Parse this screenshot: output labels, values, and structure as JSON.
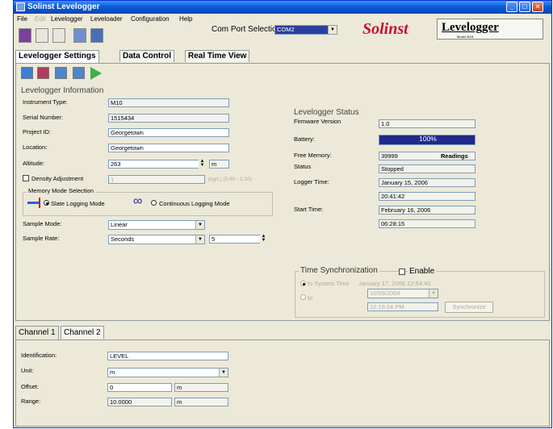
{
  "window": {
    "title": "Solinst Levelogger"
  },
  "menu": [
    "File",
    "Edit",
    "Levelogger",
    "Leveloader",
    "Configuration",
    "Help"
  ],
  "com_port": {
    "label": "Com Port Selection:",
    "value": "COM2"
  },
  "brand": {
    "name": "Solinst",
    "product": "Levelogger",
    "model": "Model 3001"
  },
  "tabs": [
    "Levelogger Settings",
    "Data Control",
    "Real Time View"
  ],
  "info": {
    "title": "Levelogger Information",
    "instrument_type_label": "Instrument Type:",
    "instrument_type": "M10",
    "serial_label": "Serial Number:",
    "serial": "1515434",
    "project_label": "Project ID:",
    "project": "Georgetown",
    "location_label": "Location:",
    "location": "Georgetown",
    "altitude_label": "Altitude:",
    "altitude": "263",
    "altitude_unit": "m",
    "density_label": "Density Adjustment",
    "density_value": "1",
    "density_range": "(kg/L) (0.90 - 1.10)",
    "memory_title": "Memory Mode Selection",
    "slate_label": "Slate Logging Mode",
    "continuous_label": "Continuous Logging Mode",
    "sample_mode_label": "Sample Mode:",
    "sample_mode": "Linear",
    "sample_rate_label": "Sample Rate:",
    "sample_rate_unit": "Seconds",
    "sample_rate": "5"
  },
  "status": {
    "title": "Levelogger Status",
    "firmware_label": "Firmware Version",
    "firmware": "1.0",
    "battery_label": "Battery:",
    "battery": "100%",
    "free_memory_label": "Free Memory:",
    "free_memory": "39999",
    "readings_label": "Readings",
    "status_label": "Status",
    "status_value": "Stopped",
    "logger_time_label": "Logger Time:",
    "logger_date": "January 15, 2006",
    "logger_time": "20:41:42",
    "start_time_label": "Start Time:",
    "start_date": "February 16, 2006",
    "start_time": "06:28:15"
  },
  "sync": {
    "title": "Time Synchronization",
    "enable_label": "Enable",
    "system_label": "to System Time",
    "system_time": "January 17, 2006 12:54:40",
    "to_label": "to",
    "date": "10/09/2004",
    "time": "12:19:24 PM",
    "button": "Synchronize"
  },
  "channel_tabs": [
    "Channel 1",
    "Channel 2"
  ],
  "channel": {
    "identification_label": "Identification:",
    "identification": "LEVEL",
    "unit_label": "Unit:",
    "unit": "m",
    "offset_label": "Offset:",
    "offset": "0",
    "offset_unit": "m",
    "range_label": "Range:",
    "range": "10.0000",
    "range_unit": "m"
  },
  "colors": {
    "battery_bar": "#1f2a8c",
    "title_bar": "#0a5bd6",
    "brand_red": "#c8102e"
  }
}
